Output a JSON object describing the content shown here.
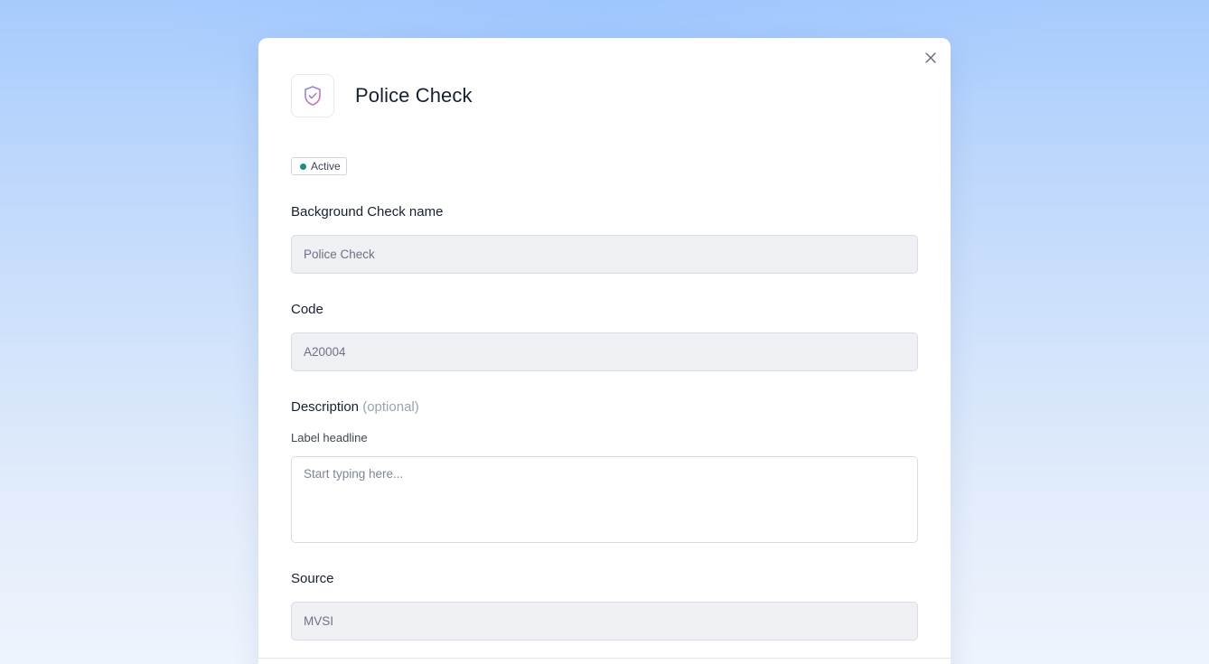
{
  "modal": {
    "title": "Police Check",
    "header_icon": "shield-check-icon",
    "close_icon": "close-icon",
    "status": {
      "label": "Active",
      "color": "#14927b"
    }
  },
  "form": {
    "name": {
      "label": "Background Check name",
      "value": "Police Check"
    },
    "code": {
      "label": "Code",
      "value": "A20004"
    },
    "description": {
      "label": "Description",
      "optional": "(optional)",
      "sub_label": "Label headline",
      "value": "",
      "placeholder": "Start typing here..."
    },
    "source": {
      "label": "Source",
      "value": "MVSI"
    }
  },
  "colors": {
    "background_top": "#a7cbfd",
    "background_bottom": "#eef4fd",
    "disabled_field": "#eef0f4",
    "text_primary": "#172033",
    "icon_gradient_start": "#7b8cf5",
    "icon_gradient_end": "#e06fa6"
  }
}
